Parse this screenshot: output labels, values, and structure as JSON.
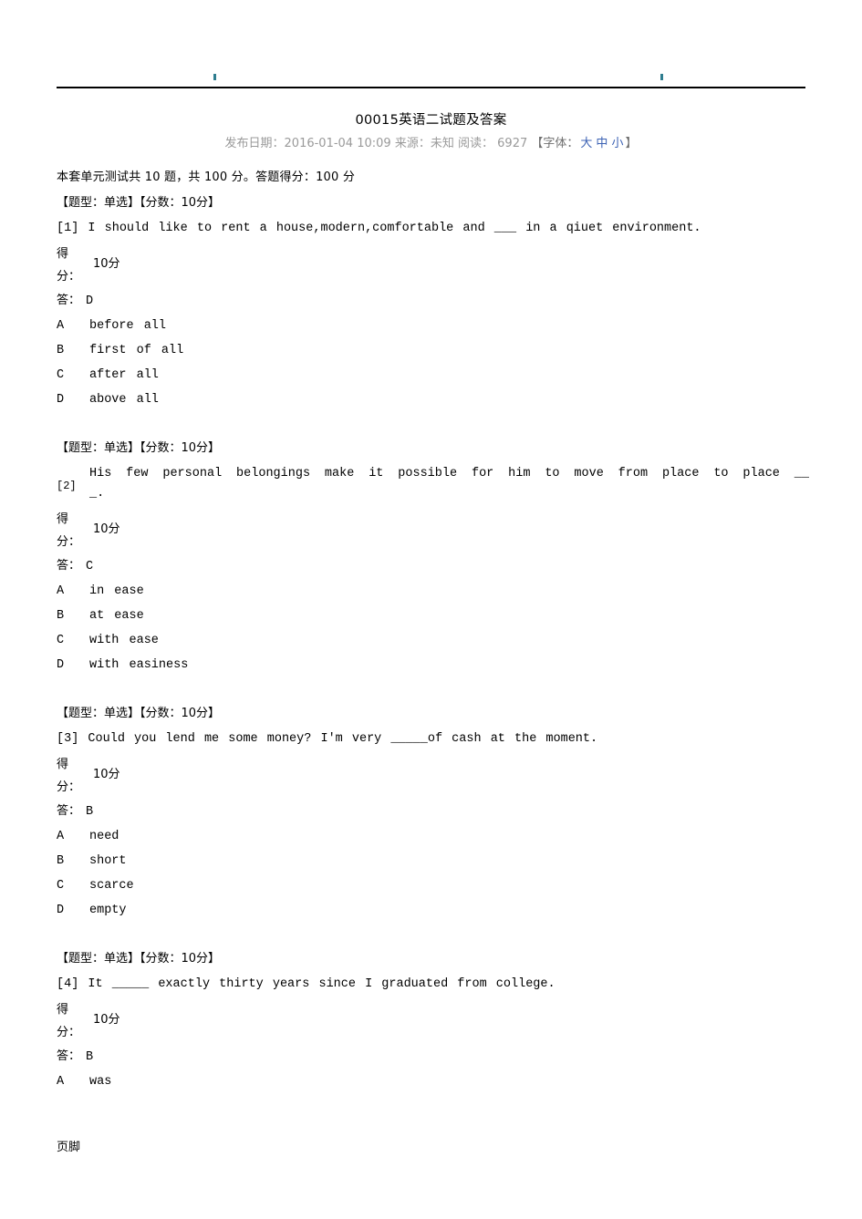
{
  "document": {
    "title": "00015英语二试题及答案",
    "meta": {
      "publish_label": "发布日期：",
      "publish_date": "2016-01-04 10:09",
      "source_label": "来源：",
      "source_value": "未知",
      "reads_label": "阅读：",
      "reads_value": "6927",
      "font_bracket_open": "【字体：",
      "font_large": "大",
      "font_medium": "中",
      "font_small": "小",
      "font_bracket_close": "】",
      "link_color": "#3c62b4"
    },
    "summary": "本套单元测试共  10  题，共  100  分。答题得分：100  分",
    "footer": "页脚"
  },
  "questions": [
    {
      "type_line": "【题型：单选】【分数：10分】",
      "index": "[1]",
      "stem": "I  should  like  to  rent  a  house,modern,comfortable  and  ___  in  a  qiuet  environment.",
      "wrapped": false,
      "score_label_top": "得",
      "score_label_bottom": "分：",
      "score_value": "10分",
      "answer_label": "答：",
      "answer_value": "D",
      "options": [
        {
          "key": "A",
          "text": "before  all"
        },
        {
          "key": "B",
          "text": "first  of  all"
        },
        {
          "key": "C",
          "text": "after  all"
        },
        {
          "key": "D",
          "text": "above  all"
        }
      ]
    },
    {
      "type_line": "【题型：单选】【分数：10分】",
      "index": "[2]",
      "stem": "His  few  personal  belongings  make  it  possible  for  him  to  move  from  place  to  place  __",
      "stem_tail": "_.",
      "wrapped": true,
      "score_label_top": "得",
      "score_label_bottom": "分：",
      "score_value": "10分",
      "answer_label": "答：",
      "answer_value": "C",
      "options": [
        {
          "key": "A",
          "text": "in  ease"
        },
        {
          "key": "B",
          "text": "at  ease"
        },
        {
          "key": "C",
          "text": "with  ease"
        },
        {
          "key": "D",
          "text": "with  easiness"
        }
      ]
    },
    {
      "type_line": "【题型：单选】【分数：10分】",
      "index": "[3]",
      "stem": "Could  you  lend  me  some  money?  I'm  very  _____of  cash  at  the  moment.",
      "wrapped": false,
      "score_label_top": "得",
      "score_label_bottom": "分：",
      "score_value": "10分",
      "answer_label": "答：",
      "answer_value": "B",
      "options": [
        {
          "key": "A",
          "text": "need"
        },
        {
          "key": "B",
          "text": "short"
        },
        {
          "key": "C",
          "text": "scarce"
        },
        {
          "key": "D",
          "text": "empty"
        }
      ]
    },
    {
      "type_line": "【题型：单选】【分数：10分】",
      "index": "[4]",
      "stem": "It  _____  exactly  thirty  years  since  I  graduated  from  college.",
      "wrapped": false,
      "score_label_top": "得",
      "score_label_bottom": "分：",
      "score_value": "10分",
      "answer_label": "答：",
      "answer_value": "B",
      "options": [
        {
          "key": "A",
          "text": "was"
        }
      ]
    }
  ]
}
